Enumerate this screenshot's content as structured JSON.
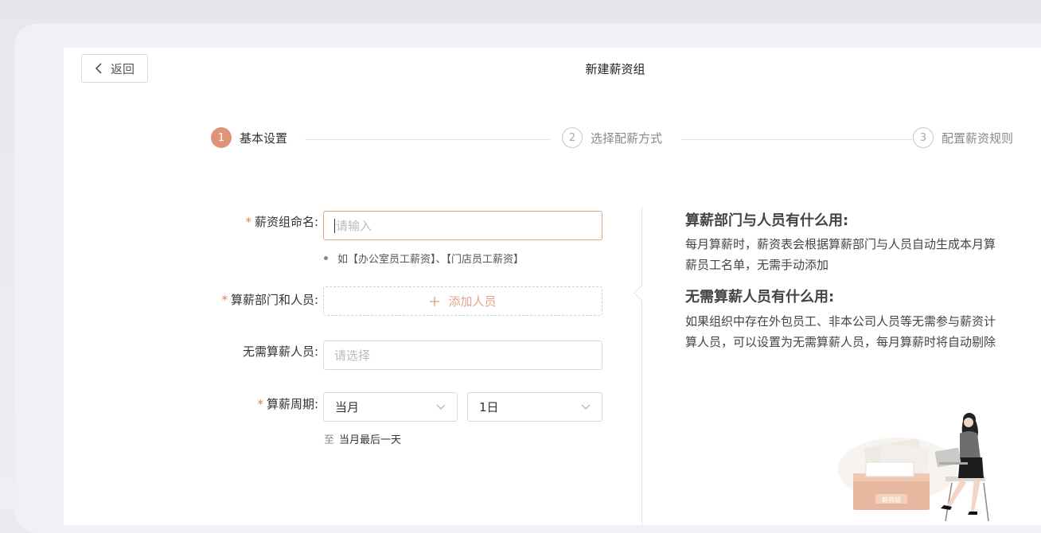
{
  "header": {
    "back_label": "返回",
    "title": "新建薪资组"
  },
  "steps": [
    {
      "num": "1",
      "label": "基本设置",
      "state": "active"
    },
    {
      "num": "2",
      "label": "选择配薪方式",
      "state": "idle"
    },
    {
      "num": "3",
      "label": "配置薪资规则",
      "state": "idle"
    }
  ],
  "form": {
    "required_mark": "*",
    "group_name": {
      "label": "薪资组命名:",
      "placeholder": "请输入",
      "value": "",
      "hint": "如【办公室员工薪资】、【门店员工薪资】"
    },
    "dept_people": {
      "label": "算薪部门和人员:",
      "add_label": "添加人员"
    },
    "excluded": {
      "label": "无需算薪人员:",
      "placeholder": "请选择"
    },
    "cycle": {
      "label": "算薪周期:",
      "month_value": "当月",
      "day_value": "1日",
      "to_prefix": "至",
      "to_text": "当月最后一天"
    }
  },
  "help": {
    "q1_title": "算薪部门与人员有什么用:",
    "q1_body": "每月算薪时，薪资表会根据算薪部门与人员自动生成本月算薪员工名单，无需手动添加",
    "q2_title": "无需算薪人员有什么用:",
    "q2_body": "如果组织中存在外包员工、非本公司人员等无需参与薪资计算人员，可以设置为无需算薪人员，每月算薪时将自动剔除",
    "illustration_tag": "薪资组"
  },
  "colors": {
    "accent": "#df9478",
    "required": "#df7c5c"
  }
}
